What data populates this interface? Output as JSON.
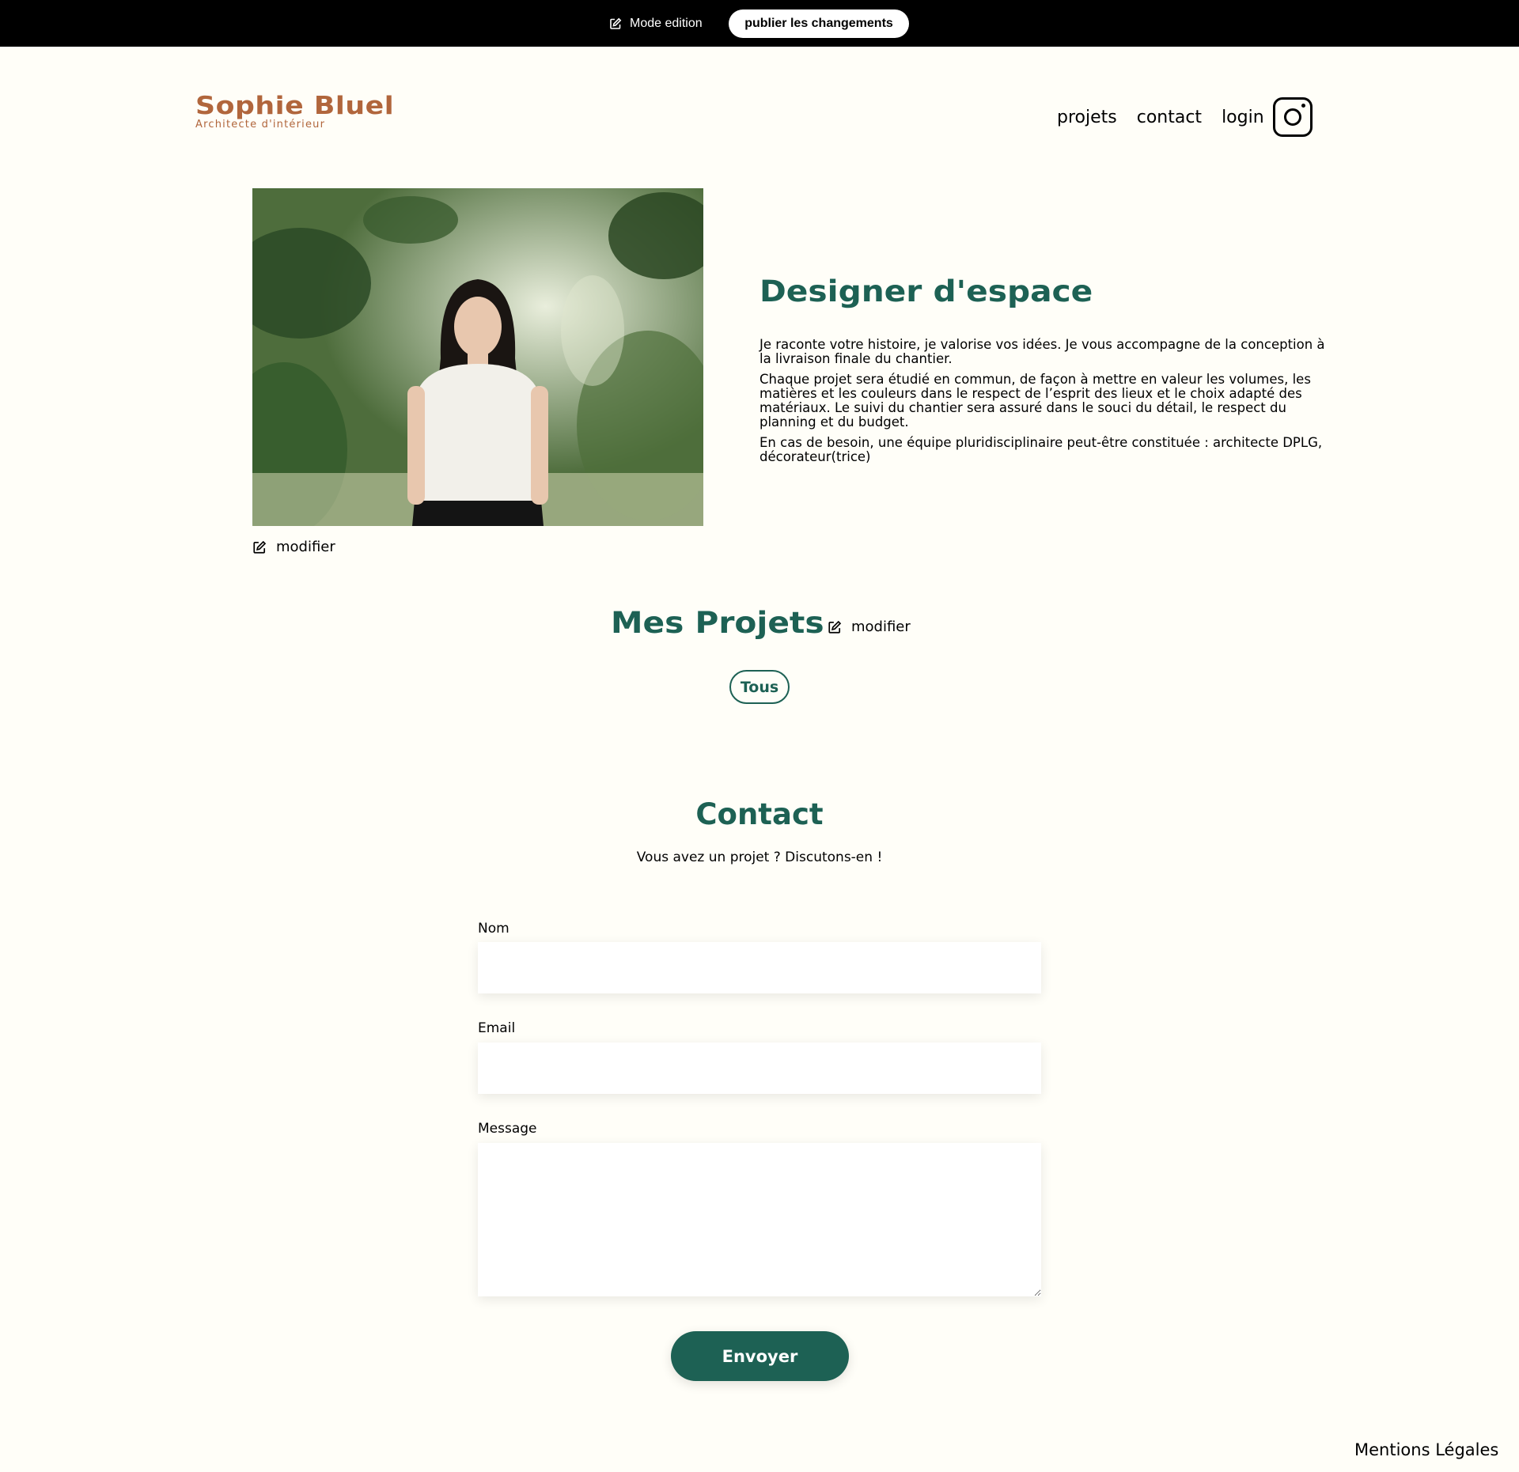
{
  "edit_bar": {
    "mode_label": "Mode edition",
    "publish_label": "publier les changements",
    "icon": "edit-icon"
  },
  "header": {
    "logo_title": "Sophie Bluel",
    "logo_subtitle": "Architecte d'intérieur",
    "nav": [
      "projets",
      "contact",
      "login"
    ],
    "social_icon": "instagram-icon"
  },
  "intro": {
    "photo_alt": "portrait",
    "modifier_label": "modifier",
    "title": "Designer d'espace",
    "paragraphs": [
      "Je raconte votre histoire, je valorise vos idées. Je vous accompagne de la conception à la livraison finale du chantier.",
      "Chaque projet sera étudié en commun, de façon à mettre en valeur les volumes, les matières et les couleurs dans le respect de l’esprit des lieux et le choix adapté des matériaux. Le suivi du chantier sera assuré dans le souci du détail, le respect du planning et du budget.",
      "En cas de besoin, une équipe pluridisciplinaire peut-être constituée : architecte DPLG, décorateur(trice)"
    ]
  },
  "projects": {
    "title": "Mes Projets",
    "modifier_label": "modifier",
    "filter_all": "Tous"
  },
  "contact": {
    "title": "Contact",
    "subtitle": "Vous avez un projet ? Discutons-en !",
    "name_label": "Nom",
    "name_value": "",
    "email_label": "Email",
    "email_value": "",
    "message_label": "Message",
    "message_value": "",
    "submit_label": "Envoyer"
  },
  "footer": {
    "legal": "Mentions Légales"
  },
  "colors": {
    "brand": "#B1663C",
    "accent": "#1D6154",
    "background": "#FFFEF8",
    "edit_bar": "#000000"
  }
}
